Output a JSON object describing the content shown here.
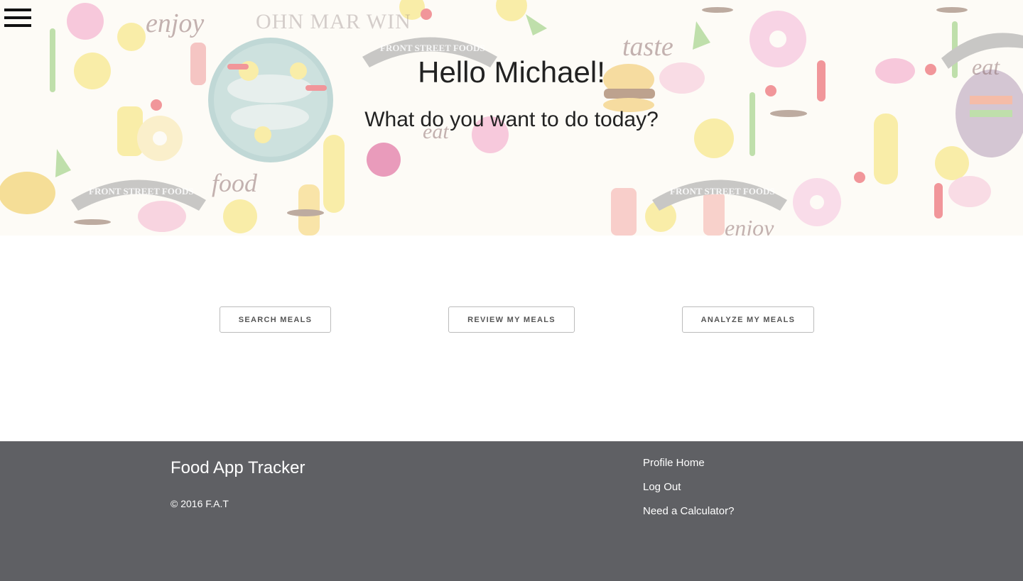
{
  "nav": {
    "menu_icon": "hamburger-menu-icon"
  },
  "hero": {
    "greeting": "Hello Michael!",
    "question": "What do you want to do today?",
    "decor_words": [
      "enjoy",
      "taste",
      "eat",
      "food",
      "eat",
      "enjoy"
    ],
    "banner_text": "FRONT STREET FOODS",
    "logo_text": "OHN MAR WIN",
    "colors": {
      "lemon": "#f7e36a",
      "pink": "#f3a0c6",
      "red": "#e8454f",
      "green": "#8dc96e",
      "teal": "#8fbcbc",
      "grey": "#9e9e9e"
    }
  },
  "actions": {
    "search": "SEARCH MEALS",
    "review": "REVIEW MY MEALS",
    "analyze": "ANALYZE MY MEALS"
  },
  "footer": {
    "title": "Food App Tracker",
    "copyright": "© 2016 F.A.T",
    "links": [
      "Profile Home",
      "Log Out",
      "Need a Calculator?"
    ],
    "background": "#5f6064"
  }
}
